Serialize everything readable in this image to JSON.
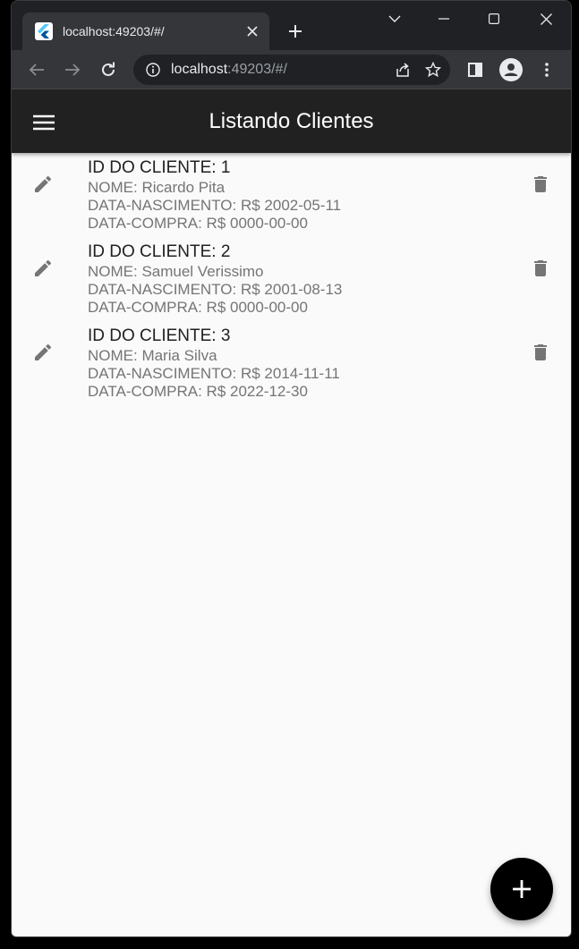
{
  "browser": {
    "tab_title": "localhost:49203/#/",
    "url_host": "localhost",
    "url_rest": ":49203/#/"
  },
  "app": {
    "title": "Listando Clientes",
    "clients": [
      {
        "title": "ID DO CLIENTE: 1",
        "nome": "NOME: Ricardo Pita",
        "nascimento": "DATA-NASCIMENTO: R$ 2002-05-11",
        "compra": "DATA-COMPRA: R$ 0000-00-00"
      },
      {
        "title": "ID DO CLIENTE: 2",
        "nome": "NOME: Samuel Verissimo",
        "nascimento": "DATA-NASCIMENTO: R$ 2001-08-13",
        "compra": "DATA-COMPRA: R$ 0000-00-00"
      },
      {
        "title": "ID DO CLIENTE: 3",
        "nome": "NOME: Maria Silva",
        "nascimento": "DATA-NASCIMENTO: R$ 2014-11-11",
        "compra": "DATA-COMPRA: R$ 2022-12-30"
      }
    ]
  },
  "colors": {
    "appbar": "#212121",
    "background": "#fafafa",
    "icon": "#757575",
    "fab": "#000000"
  },
  "icons": {
    "menu": "hamburger-menu-icon",
    "edit": "pencil-icon",
    "delete": "trash-icon",
    "add": "plus-icon"
  }
}
